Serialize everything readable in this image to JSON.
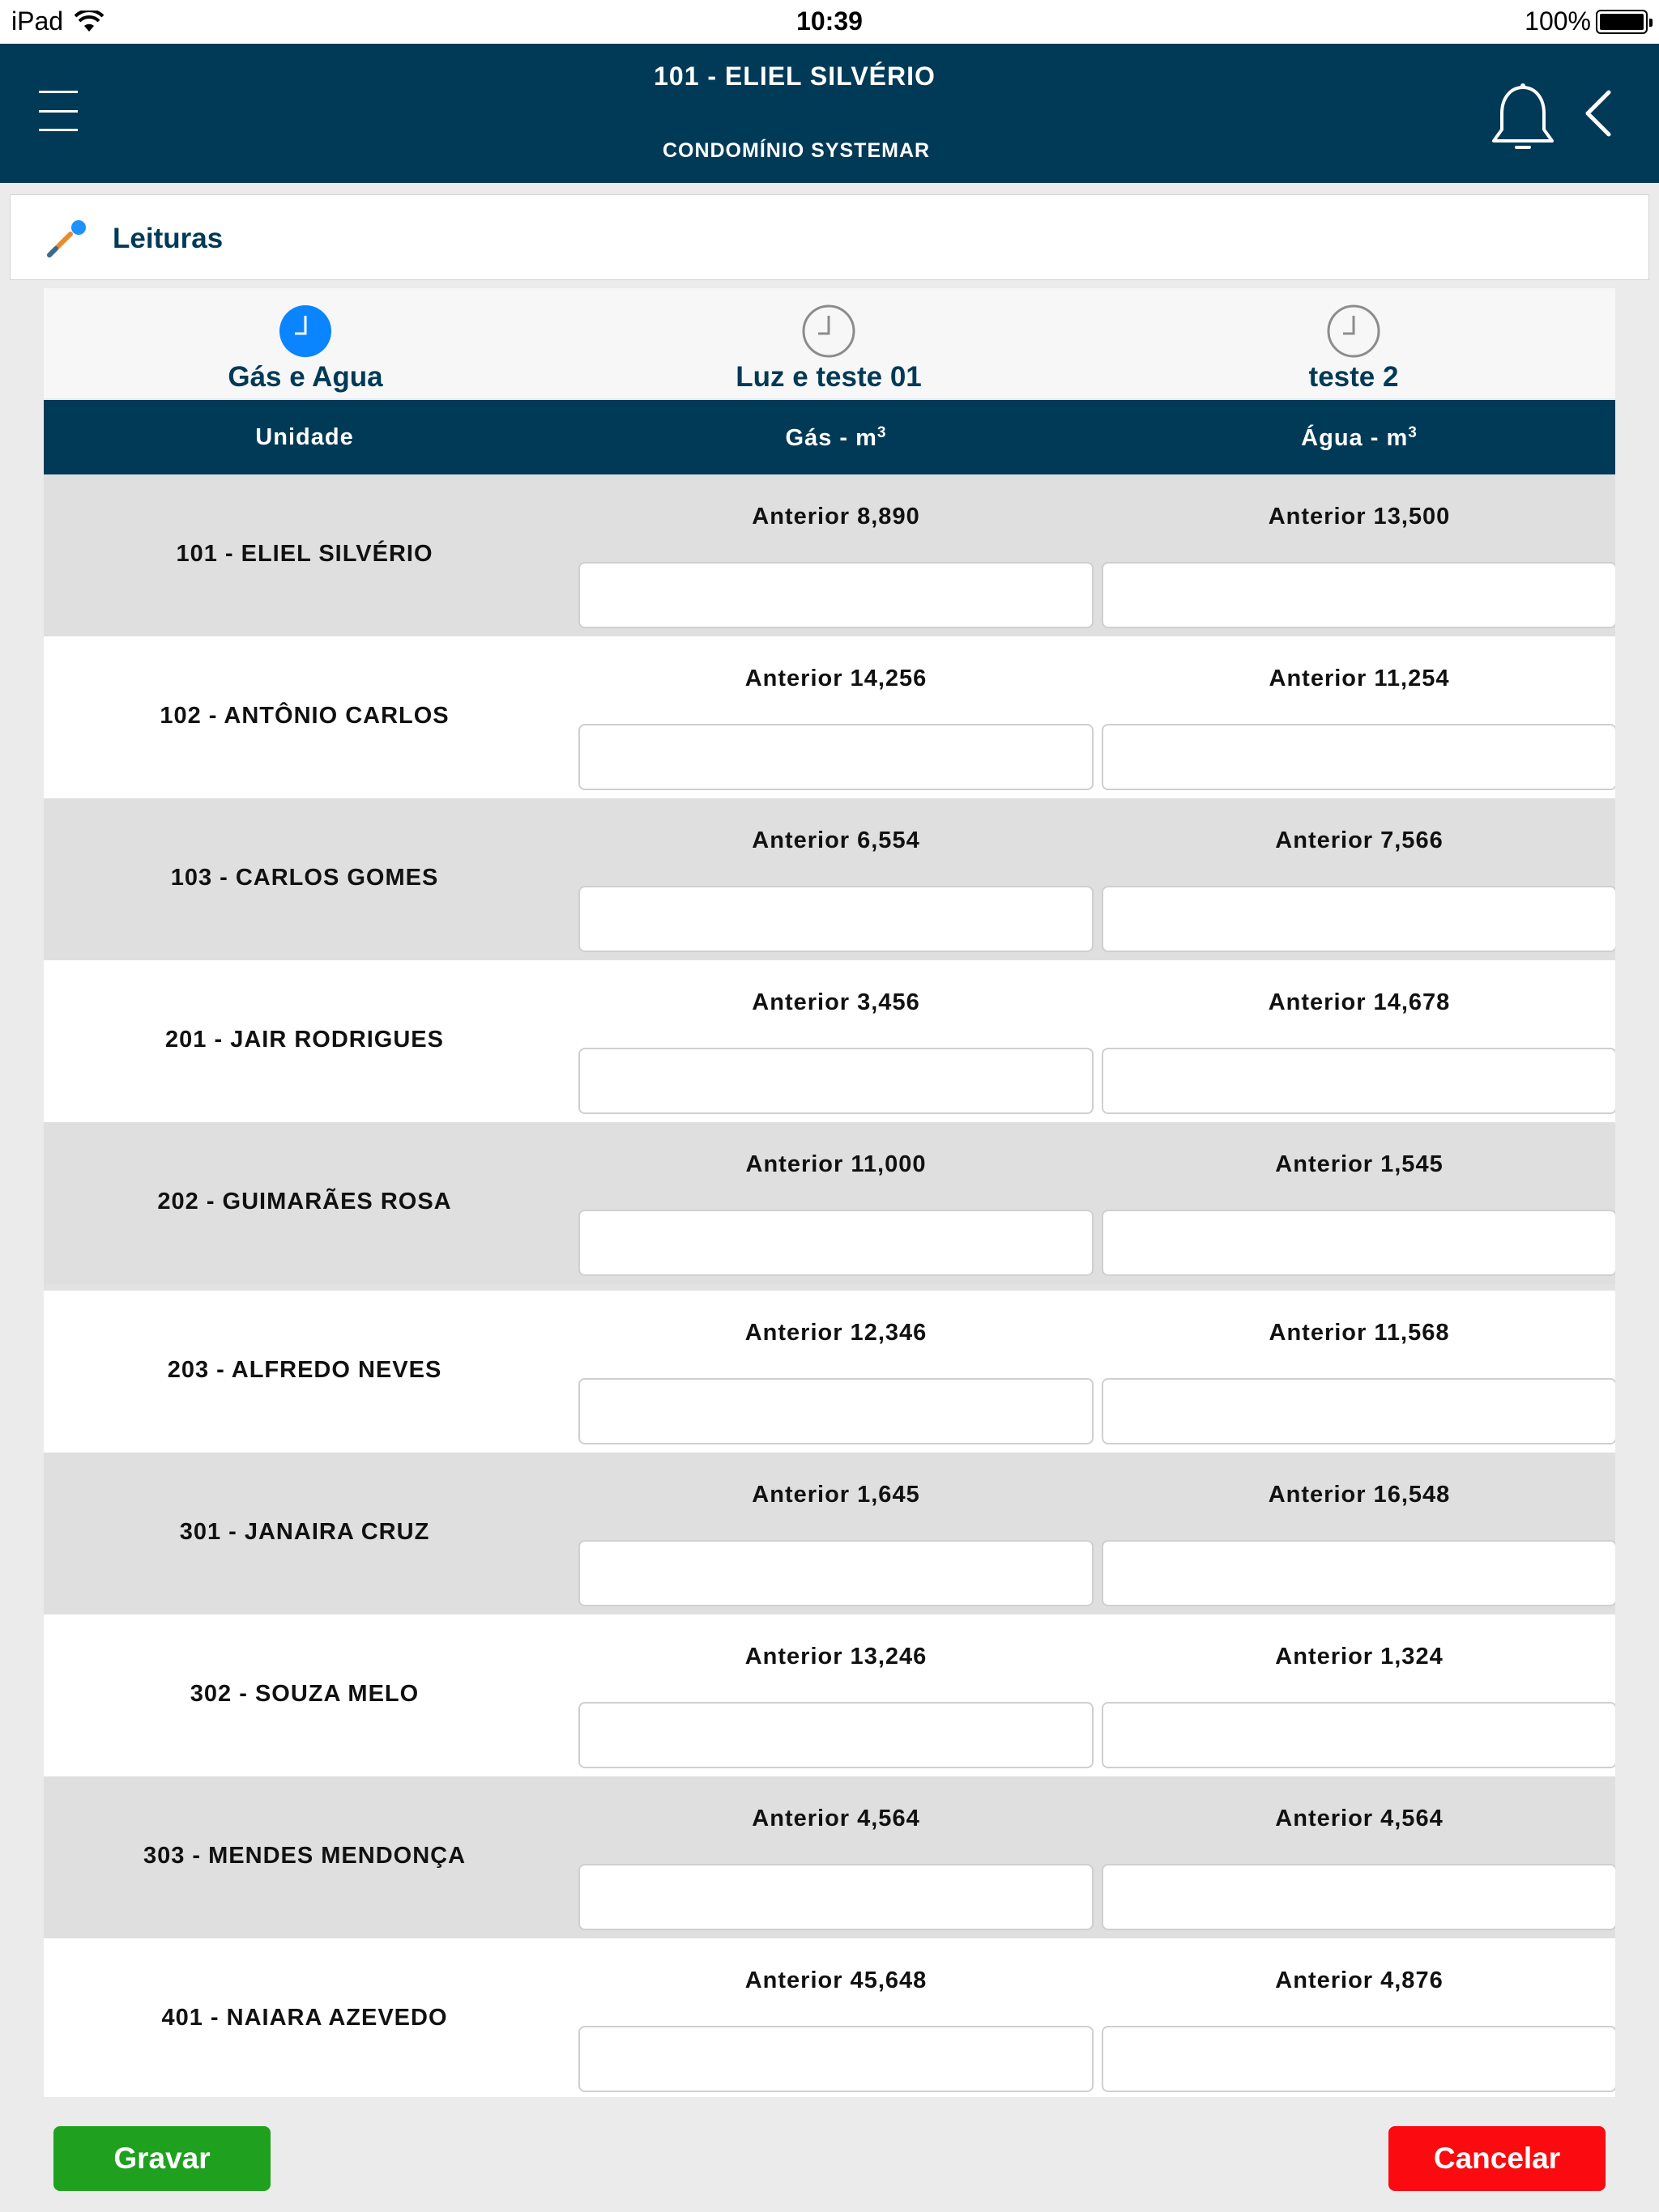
{
  "status_bar": {
    "device": "iPad",
    "time": "10:39",
    "battery": "100%"
  },
  "header": {
    "title": "101 - ELIEL SILVÉRIO",
    "subtitle": "CONDOMÍNIO SYSTEMAR"
  },
  "section": {
    "title": "Leituras"
  },
  "tabs": [
    {
      "label": "Gás e Agua",
      "active": true
    },
    {
      "label": "Luz e teste 01",
      "active": false
    },
    {
      "label": "teste 2",
      "active": false
    }
  ],
  "table": {
    "headers": {
      "unit": "Unidade",
      "col1": "Gás - m",
      "col2": "Água - m",
      "unit_exp": "3"
    },
    "rows": [
      {
        "unit": "101 - ELIEL SILVÉRIO",
        "prev1": "Anterior 8,890",
        "prev2": "Anterior 13,500"
      },
      {
        "unit": "102 - ANTÔNIO CARLOS",
        "prev1": "Anterior 14,256",
        "prev2": "Anterior 11,254"
      },
      {
        "unit": "103 - CARLOS GOMES",
        "prev1": "Anterior 6,554",
        "prev2": "Anterior 7,566"
      },
      {
        "unit": "201 - JAIR RODRIGUES",
        "prev1": "Anterior 3,456",
        "prev2": "Anterior 14,678"
      },
      {
        "unit": "202 - GUIMARÃES ROSA",
        "prev1": "Anterior 11,000",
        "prev2": "Anterior 1,545"
      },
      {
        "unit": "203 - ALFREDO NEVES",
        "prev1": "Anterior 12,346",
        "prev2": "Anterior 11,568"
      },
      {
        "unit": "301 - JANAIRA CRUZ",
        "prev1": "Anterior 1,645",
        "prev2": "Anterior 16,548"
      },
      {
        "unit": "302 - SOUZA MELO",
        "prev1": "Anterior 13,246",
        "prev2": "Anterior 1,324"
      },
      {
        "unit": "303 - MENDES MENDONÇA",
        "prev1": "Anterior 4,564",
        "prev2": "Anterior 4,564"
      },
      {
        "unit": "401 - NAIARA AZEVEDO",
        "prev1": "Anterior 45,648",
        "prev2": "Anterior 4,876"
      }
    ]
  },
  "footer": {
    "save_label": "Gravar",
    "cancel_label": "Cancelar"
  },
  "colors": {
    "header_bg": "#003a57",
    "active_tab": "#0a84ff",
    "save": "#1fa11f",
    "cancel": "#fb0a0f"
  },
  "icons": {
    "menu": "hamburger-icon",
    "bell": "bell-icon",
    "back": "chevron-left-icon",
    "section": "probe-icon",
    "tab": "clock-icon",
    "wifi": "wifi-icon",
    "battery": "battery-icon"
  }
}
